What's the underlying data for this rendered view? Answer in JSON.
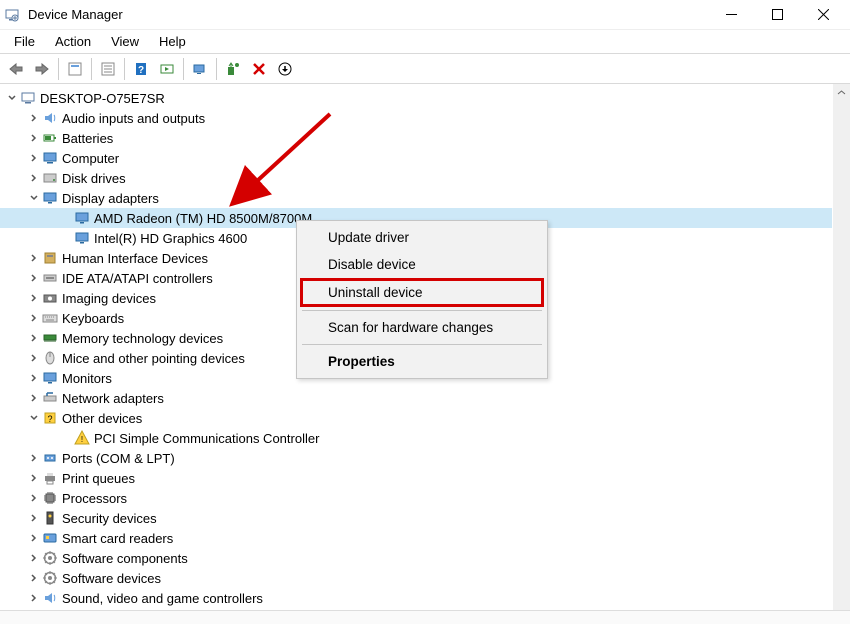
{
  "window": {
    "title": "Device Manager"
  },
  "menu": {
    "file": "File",
    "action": "Action",
    "view": "View",
    "help": "Help"
  },
  "tree": {
    "root": "DESKTOP-O75E7SR",
    "items": [
      {
        "label": "Audio inputs and outputs",
        "icon": "audio"
      },
      {
        "label": "Batteries",
        "icon": "battery"
      },
      {
        "label": "Computer",
        "icon": "computer"
      },
      {
        "label": "Disk drives",
        "icon": "disk"
      },
      {
        "label": "Display adapters",
        "icon": "display",
        "expanded": true,
        "children": [
          {
            "label": "AMD Radeon (TM) HD 8500M/8700M",
            "icon": "display",
            "selected": true
          },
          {
            "label": "Intel(R) HD Graphics 4600",
            "icon": "display"
          }
        ]
      },
      {
        "label": "Human Interface Devices",
        "icon": "hid"
      },
      {
        "label": "IDE ATA/ATAPI controllers",
        "icon": "ide"
      },
      {
        "label": "Imaging devices",
        "icon": "imaging"
      },
      {
        "label": "Keyboards",
        "icon": "keyboard"
      },
      {
        "label": "Memory technology devices",
        "icon": "memory"
      },
      {
        "label": "Mice and other pointing devices",
        "icon": "mouse"
      },
      {
        "label": "Monitors",
        "icon": "monitor"
      },
      {
        "label": "Network adapters",
        "icon": "network"
      },
      {
        "label": "Other devices",
        "icon": "unknown",
        "expanded": true,
        "children": [
          {
            "label": "PCI Simple Communications Controller",
            "icon": "unknown-child"
          }
        ]
      },
      {
        "label": "Ports (COM & LPT)",
        "icon": "port"
      },
      {
        "label": "Print queues",
        "icon": "printer"
      },
      {
        "label": "Processors",
        "icon": "cpu"
      },
      {
        "label": "Security devices",
        "icon": "security"
      },
      {
        "label": "Smart card readers",
        "icon": "smartcard"
      },
      {
        "label": "Software components",
        "icon": "software"
      },
      {
        "label": "Software devices",
        "icon": "software"
      },
      {
        "label": "Sound, video and game controllers",
        "icon": "sound"
      }
    ]
  },
  "context_menu": {
    "update": "Update driver",
    "disable": "Disable device",
    "uninstall": "Uninstall device",
    "scan": "Scan for hardware changes",
    "properties": "Properties"
  }
}
